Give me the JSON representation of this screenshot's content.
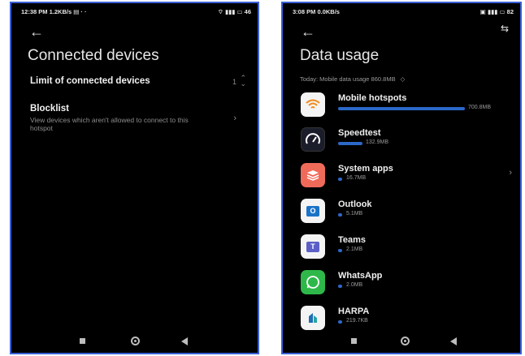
{
  "screen1": {
    "status": {
      "time": "12:38 PM",
      "speed": "1.2KB/s",
      "battery": "46"
    },
    "title": "Connected devices",
    "limit_row": {
      "label": "Limit of connected devices",
      "value": "1"
    },
    "blocklist": {
      "title": "Blocklist",
      "subtitle": "View devices which aren't allowed to connect to this hotspot"
    }
  },
  "screen2": {
    "status": {
      "time": "3:08 PM",
      "speed": "0.0KB/s",
      "battery": "82"
    },
    "title": "Data usage",
    "summary": "Today: Mobile data usage 860.8MB",
    "apps": [
      {
        "name": "Mobile hotspots",
        "usage": "700.8MB",
        "icon": "wifi-hotspot-icon",
        "fraction": 1.0
      },
      {
        "name": "Speedtest",
        "usage": "132.9MB",
        "icon": "speedtest-icon",
        "fraction": 0.19
      },
      {
        "name": "System apps",
        "usage": "16.7MB",
        "icon": "system-apps-icon",
        "fraction": 0.02
      },
      {
        "name": "Outlook",
        "usage": "5.1MB",
        "icon": "outlook-icon",
        "fraction": 0.01
      },
      {
        "name": "Teams",
        "usage": "2.1MB",
        "icon": "teams-icon",
        "fraction": 0.005
      },
      {
        "name": "WhatsApp",
        "usage": "2.0MB",
        "icon": "whatsapp-icon",
        "fraction": 0.005
      },
      {
        "name": "HARPA",
        "usage": "219.7KB",
        "icon": "harpa-icon",
        "fraction": 0.001
      }
    ]
  },
  "colors": {
    "accent": "#2b68c8",
    "frame": "#3a5fd6",
    "background": "#000000"
  }
}
